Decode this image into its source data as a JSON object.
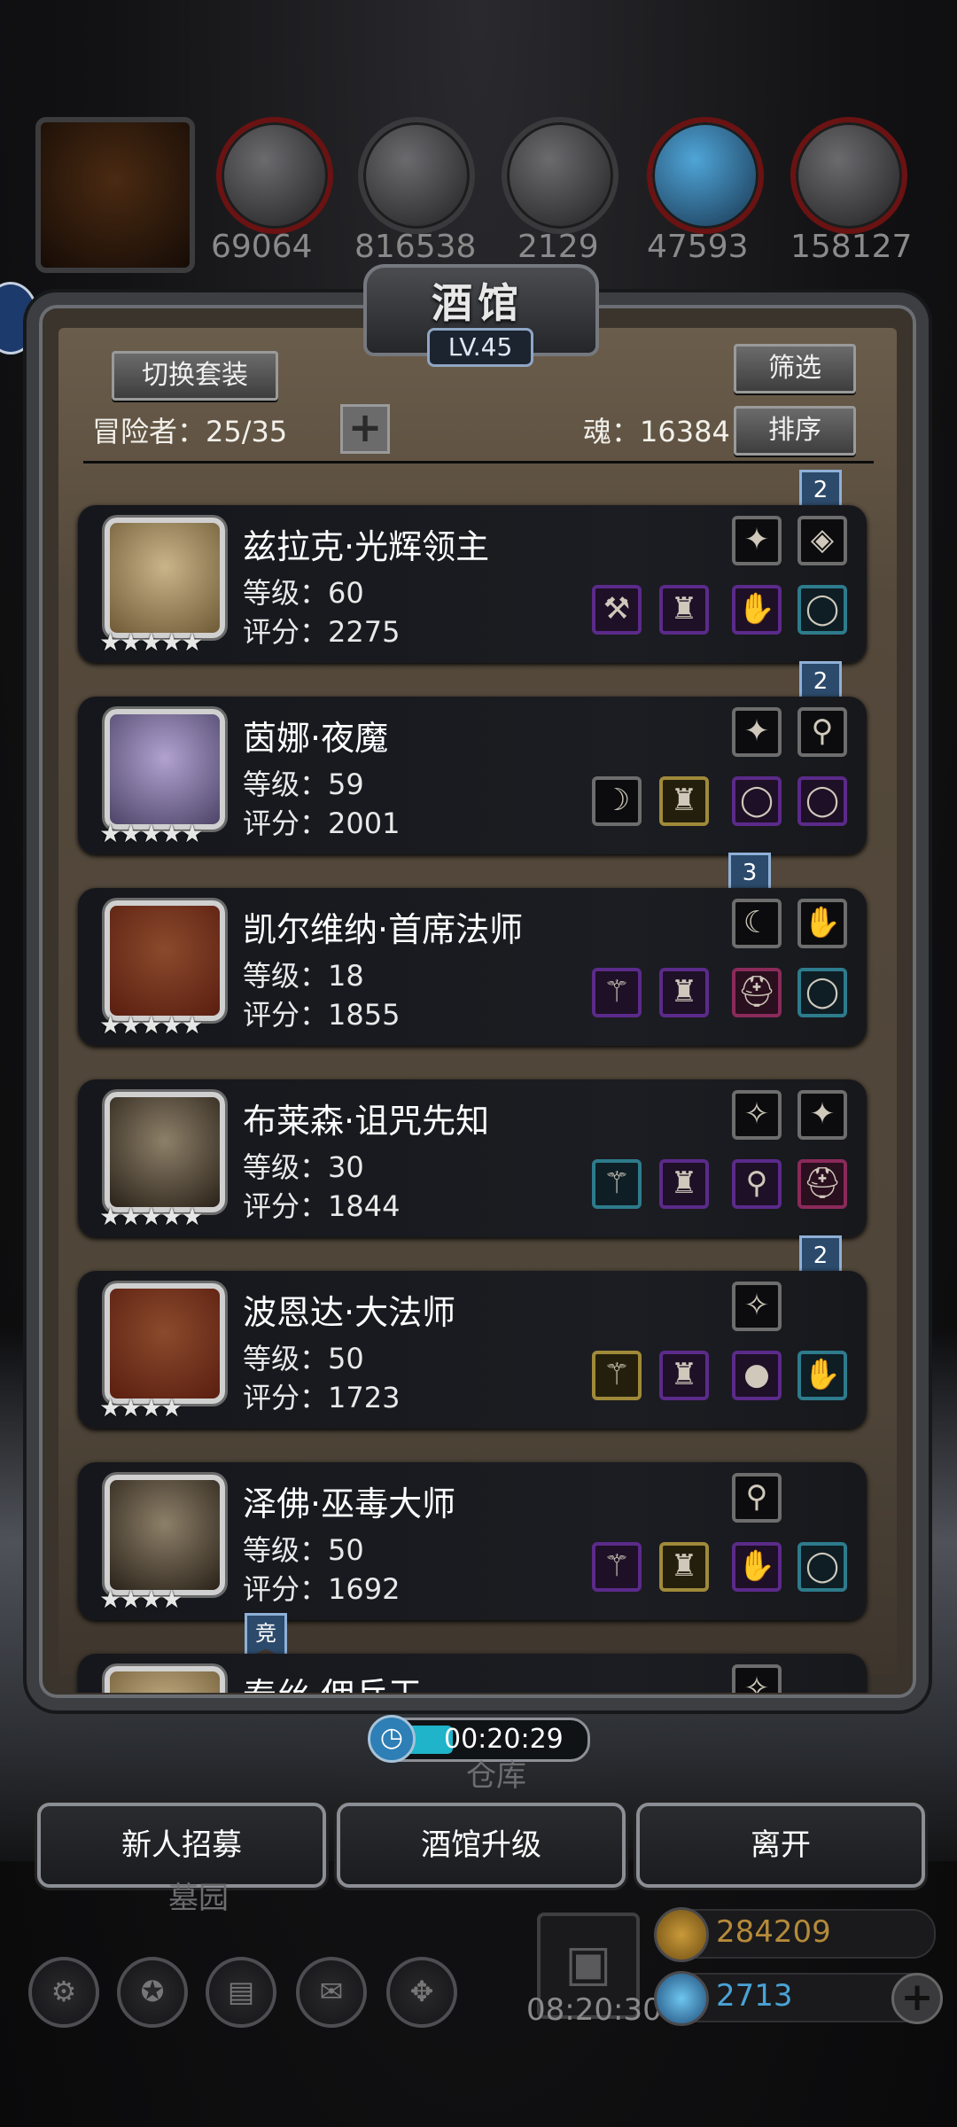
{
  "resources": [
    {
      "icon": "helmet-icon",
      "value": "69064"
    },
    {
      "icon": "meat-icon",
      "value": "816538"
    },
    {
      "icon": "wood-icon",
      "value": "816538"
    },
    {
      "icon": "iron-icon",
      "value": "2129"
    },
    {
      "icon": "crystal-icon",
      "value": "47593"
    },
    {
      "icon": "stone-icon",
      "value": "158127"
    }
  ],
  "resource_labels": [
    "69064",
    "816538",
    "2129",
    "47593",
    "158127"
  ],
  "panel": {
    "title": "酒馆",
    "level": "LV.45",
    "switch_set_label": "切换套装",
    "filter_label": "筛选",
    "sort_label": "排序",
    "adventurers_label": "冒险者：25/35",
    "plus_label": "+",
    "soul_label": "魂：16384"
  },
  "heroes": [
    {
      "name": "兹拉克·光辉领主",
      "level": "等级：60",
      "score": "评分：2275",
      "stars": "★★★★★",
      "portrait": "old-dwarf",
      "ribbon": "2"
    },
    {
      "name": "茵娜·夜魔",
      "level": "等级：59",
      "score": "评分：2001",
      "stars": "★★★★★",
      "portrait": "dark-elf",
      "ribbon": "2"
    },
    {
      "name": "凯尔维纳·首席法师",
      "level": "等级：18",
      "score": "评分：1855",
      "stars": "★★★★★",
      "portrait": "mage",
      "ribbon": "3"
    },
    {
      "name": "布莱森·诅咒先知",
      "level": "等级：30",
      "score": "评分：1844",
      "stars": "★★★★★",
      "portrait": "prophet",
      "ribbon": ""
    },
    {
      "name": "波恩达·大法师",
      "level": "等级：50",
      "score": "评分：1723",
      "stars": "★★★★",
      "portrait": "mage",
      "ribbon": "2"
    },
    {
      "name": "泽佛·巫毒大师",
      "level": "等级：50",
      "score": "评分：1692",
      "stars": "★★★★",
      "portrait": "voodoo",
      "ribbon": ""
    },
    {
      "name": "泰丝·佣兵王",
      "level": "",
      "score": "",
      "stars": "",
      "portrait": "mercenary",
      "ribbon": "竞"
    }
  ],
  "timer": "00:20:29",
  "warehouse_label": "仓库",
  "cemetery_label": "墓园",
  "buttons": {
    "recruit": "新人招募",
    "upgrade": "酒馆升级",
    "leave": "离开"
  },
  "gift_timer": "08:20:30",
  "gold": "284209",
  "gems": "2713",
  "gem_plus": "+",
  "colors": {
    "gold_text": "#b58a3a",
    "gem_text": "#4aa3d6",
    "panel_frame": "#3c3e42",
    "ribbon": "#2c4a6b"
  }
}
